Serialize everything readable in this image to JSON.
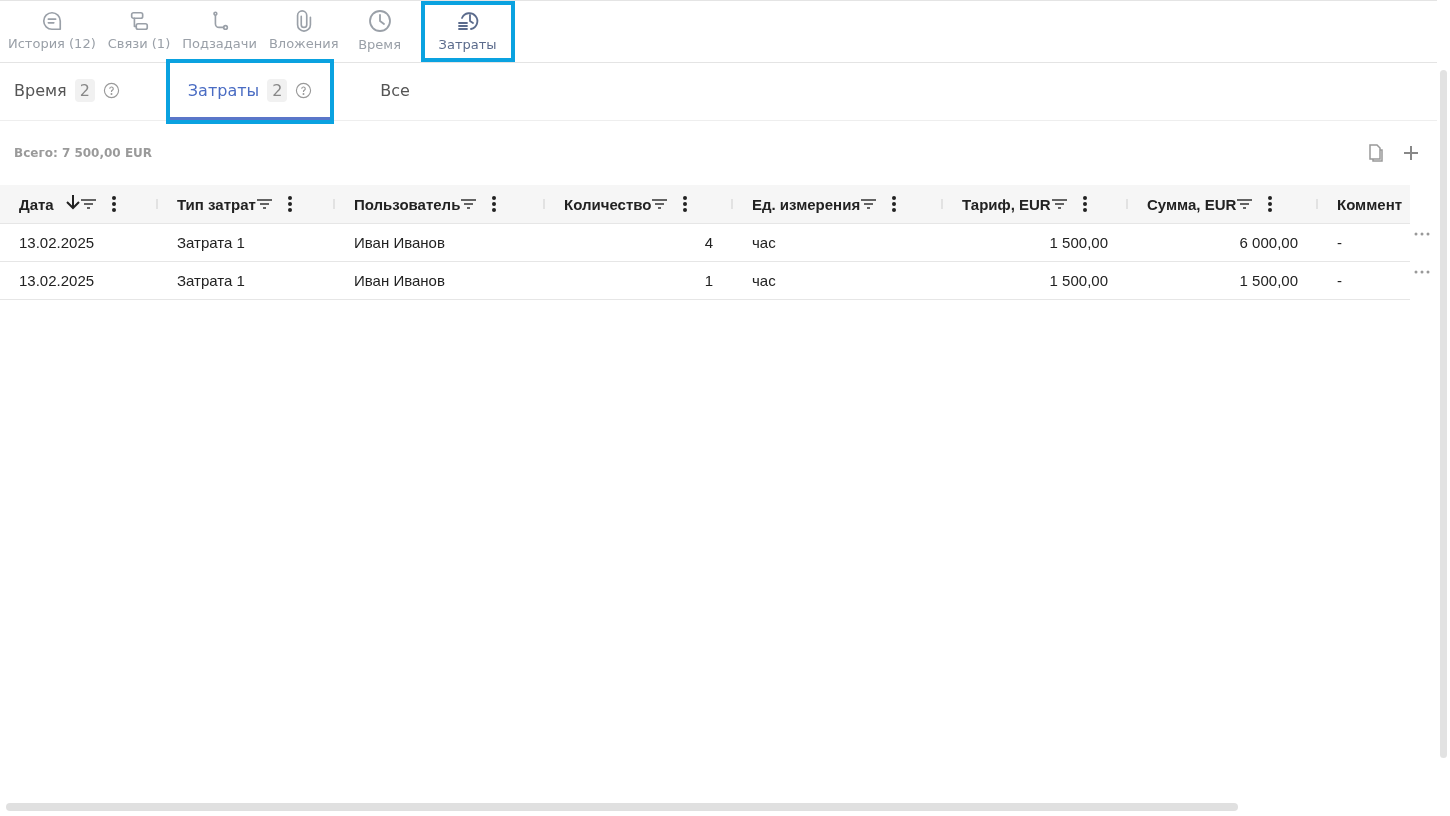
{
  "top_tabs": [
    {
      "label": "История (12)",
      "selected": false,
      "highlighted": false
    },
    {
      "label": "Связи (1)",
      "selected": false,
      "highlighted": false
    },
    {
      "label": "Подзадачи",
      "selected": false,
      "highlighted": false
    },
    {
      "label": "Вложения",
      "selected": false,
      "highlighted": false
    },
    {
      "label": "Время",
      "selected": false,
      "highlighted": false
    },
    {
      "label": "Затраты",
      "selected": true,
      "highlighted": true
    }
  ],
  "sub_tabs": [
    {
      "label": "Время",
      "count": "2",
      "selected": false,
      "highlighted": false
    },
    {
      "label": "Затраты",
      "count": "2",
      "selected": true,
      "highlighted": true
    },
    {
      "label": "Все",
      "selected": false,
      "highlighted": false
    }
  ],
  "total": "Всего: 7 500,00 EUR",
  "table": {
    "columns": [
      {
        "label": "Дата",
        "sorted": true,
        "kind": "text"
      },
      {
        "label": "Тип затрат",
        "sorted": false,
        "kind": "text"
      },
      {
        "label": "Пользователь",
        "sorted": false,
        "kind": "text"
      },
      {
        "label": "Количество",
        "sorted": false,
        "kind": "number"
      },
      {
        "label": "Ед. измерения",
        "sorted": false,
        "kind": "text"
      },
      {
        "label": "Тариф, EUR",
        "sorted": false,
        "kind": "number"
      },
      {
        "label": "Сумма, EUR",
        "sorted": false,
        "kind": "number"
      },
      {
        "label": "Коммент",
        "sorted": false,
        "kind": "text"
      }
    ],
    "rows": [
      [
        "13.02.2025",
        "Затрата 1",
        "Иван Иванов",
        "4",
        "час",
        "1 500,00",
        "6 000,00",
        "-"
      ],
      [
        "13.02.2025",
        "Затрата 1",
        "Иван Иванов",
        "1",
        "час",
        "1 500,00",
        "1 500,00",
        "-"
      ]
    ]
  }
}
